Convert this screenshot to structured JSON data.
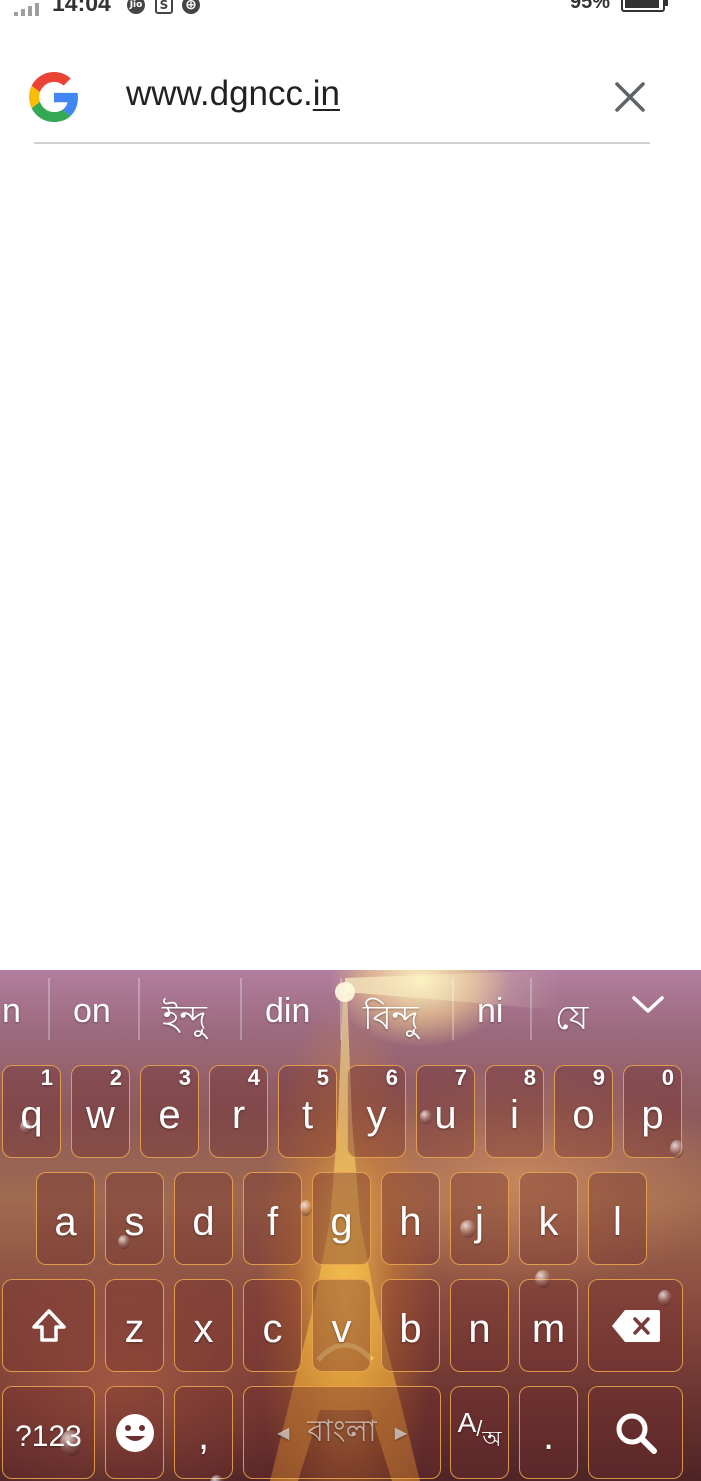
{
  "status_bar": {
    "time": "14:04",
    "notif_icons": [
      "Jio",
      "S",
      "⊕"
    ],
    "overflow": "···",
    "battery_percent": "95%",
    "battery_level": 0.95
  },
  "search": {
    "query_prefix": "www.dgncc.",
    "query_composing": "in",
    "clear_icon": "close-icon"
  },
  "keyboard": {
    "suggestions": [
      "n",
      "on",
      "ইন্দু",
      "din",
      "বিন্দু",
      "ni",
      "যে"
    ],
    "row1": [
      {
        "key": "q",
        "hint": "1"
      },
      {
        "key": "w",
        "hint": "2"
      },
      {
        "key": "e",
        "hint": "3"
      },
      {
        "key": "r",
        "hint": "4"
      },
      {
        "key": "t",
        "hint": "5"
      },
      {
        "key": "y",
        "hint": "6"
      },
      {
        "key": "u",
        "hint": "7"
      },
      {
        "key": "i",
        "hint": "8"
      },
      {
        "key": "o",
        "hint": "9"
      },
      {
        "key": "p",
        "hint": "0"
      }
    ],
    "row2": [
      "a",
      "s",
      "d",
      "f",
      "g",
      "h",
      "j",
      "k",
      "l"
    ],
    "row3": [
      "z",
      "x",
      "c",
      "v",
      "b",
      "n",
      "m"
    ],
    "symbols_label": "?123",
    "comma_label": ",",
    "space_label": "বাংলা",
    "lang_switch_main": "A",
    "lang_switch_sub": "অ",
    "period_label": ".",
    "accent_color": "#f0aa50"
  }
}
